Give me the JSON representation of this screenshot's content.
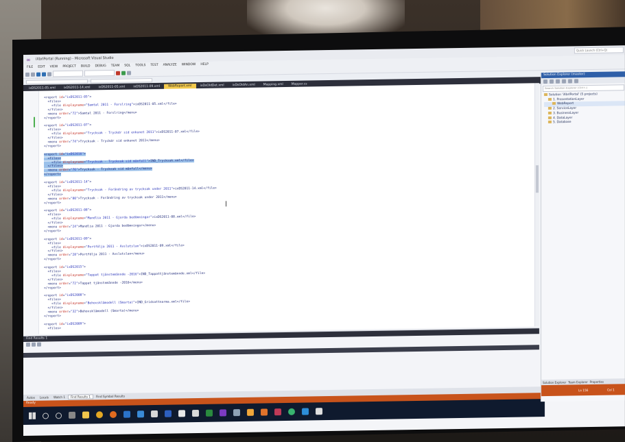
{
  "ide": {
    "title": "iXbrlPortal (Running) - Microsoft Visual Studio",
    "quick_launch": "Quick Launch (Ctrl+Q)",
    "menu": [
      "FILE",
      "EDIT",
      "VIEW",
      "PROJECT",
      "BUILD",
      "DEBUG",
      "TEAM",
      "SQL",
      "TOOLS",
      "TEST",
      "ANALYZE",
      "WINDOW",
      "HELP"
    ],
    "tabs": [
      "ixDS2011-05.xml",
      "ixDS2011-14.xml",
      "ixDS2011-05.xml",
      "ixDS2011-09.xml",
      "WebReport.xml",
      "ixDsOldDet.xml",
      "ixDsOldAn.xml",
      "Mapping.xml",
      "Mapper.cs"
    ],
    "active_tab_index": 4
  },
  "editor": {
    "lines": [
      "<report id=\"ixDS2011-05\">",
      "  <files>",
      "    <file displayname=\"Samtal 2011 - Forslring\">ixDS2011-05.xml</file>",
      "  </files>",
      "  <menu order=\"72\">Samtal 2011 - Forslring</menu>",
      "</report>",
      "",
      "<report id=\"ixDS2011-07\">",
      "  <files>",
      "    <file displayname=\"Trycksak - Tryckdr sid enkunet 2011\">ixDS2011-07.xml</file>",
      "  </files>",
      "  <menu order=\"74\">Trycksak - Tryckdr sid enkunet 2011</menu>",
      "</report>",
      "",
      "<report id=\"ixDS2016\">",
      "  <files>",
      "    <file displayname=\"Trycksak - Trycksak sid mänfall\">IND_Trycksak.xml</file>",
      "  </files>",
      "  <menu order=\"76\">Trycksak - Trycksak sid mänfall</menu>",
      "</report>",
      "",
      "<report id=\"ixDS2011-14\">",
      "  <files>",
      "    <file displayname=\"Trycksak - Forändring av trycksak under 2011\">ixDS2011-14.xml</file>",
      "  </files>",
      "  <menu order=\"80\">Trycksak - Forändring av trycksak under 2011</menu>",
      "</report>",
      "",
      "<report id=\"ixDS2011-08\">",
      "  <files>",
      "    <file displayname=\"Mandlia 2011 - Gjorda bedömningar\">ixDS2011-08.xml</file>",
      "  </files>",
      "  <menu order=\"24\">Mandlia 2011 - Gjorda bedömningar</menu>",
      "</report>",
      "",
      "<report id=\"ixDS2011-09\">",
      "  <files>",
      "    <file displayname=\"Portfölja 2011 - Avslutslan\">ixDS2011-09.xml</file>",
      "  </files>",
      "  <menu order=\"28\">Portfölja 2011 - Avslutslan</menu>",
      "</report>",
      "",
      "<report id=\"ixDS2015\">",
      "  <files>",
      "    <file displayname=\"Tappat tjänstemännde -2016\">IND_Tappattjänstemännde.xml</file>",
      "  </files>",
      "  <menu order=\"72\">Tappat tjänstemännde -2016</menu>",
      "</report>",
      "",
      "<report id=\"ixDS2008\">",
      "  <files>",
      "    <file displayname=\"Behovsklämodell (Smarta)\">IND_Gridsattnarma.xml</file>",
      "  </files>",
      "  <menu order=\"32\">Behovsklämodell (Smarta)</menu>",
      "</report>",
      "",
      "<report id=\"ixDS2009\">",
      "  <files>"
    ],
    "selected_line_start": 14,
    "selected_line_end": 19
  },
  "find_results": {
    "title": "Find Results 1"
  },
  "bottom_tabs": [
    "Autos",
    "Locals",
    "Watch 1",
    "Find Results 1",
    "Find Symbol Results"
  ],
  "active_bottom_tab_index": 3,
  "status": {
    "left": "Ready",
    "ln": "Ln 156",
    "col": "Col 1"
  },
  "solution_explorer": {
    "title": "Solution Explorer (master)",
    "search_placeholder": "Search Solution Explorer (Ctrl+;)",
    "items": [
      "Solution 'iXbrlPortal' (5 projects)",
      "1. PresentationLayer",
      "WebReport",
      "2. ServiceLayer",
      "3. BusinessLayer",
      "4. DataLayer",
      "5. Database"
    ],
    "tabs": [
      "Solution Explorer",
      "Team Explorer",
      "Properties"
    ]
  },
  "colors": {
    "accent": "#f2c94c",
    "status_bar": "#c8531b",
    "selection": "#9bc1ea",
    "taskbar": "#0f1a2e"
  }
}
